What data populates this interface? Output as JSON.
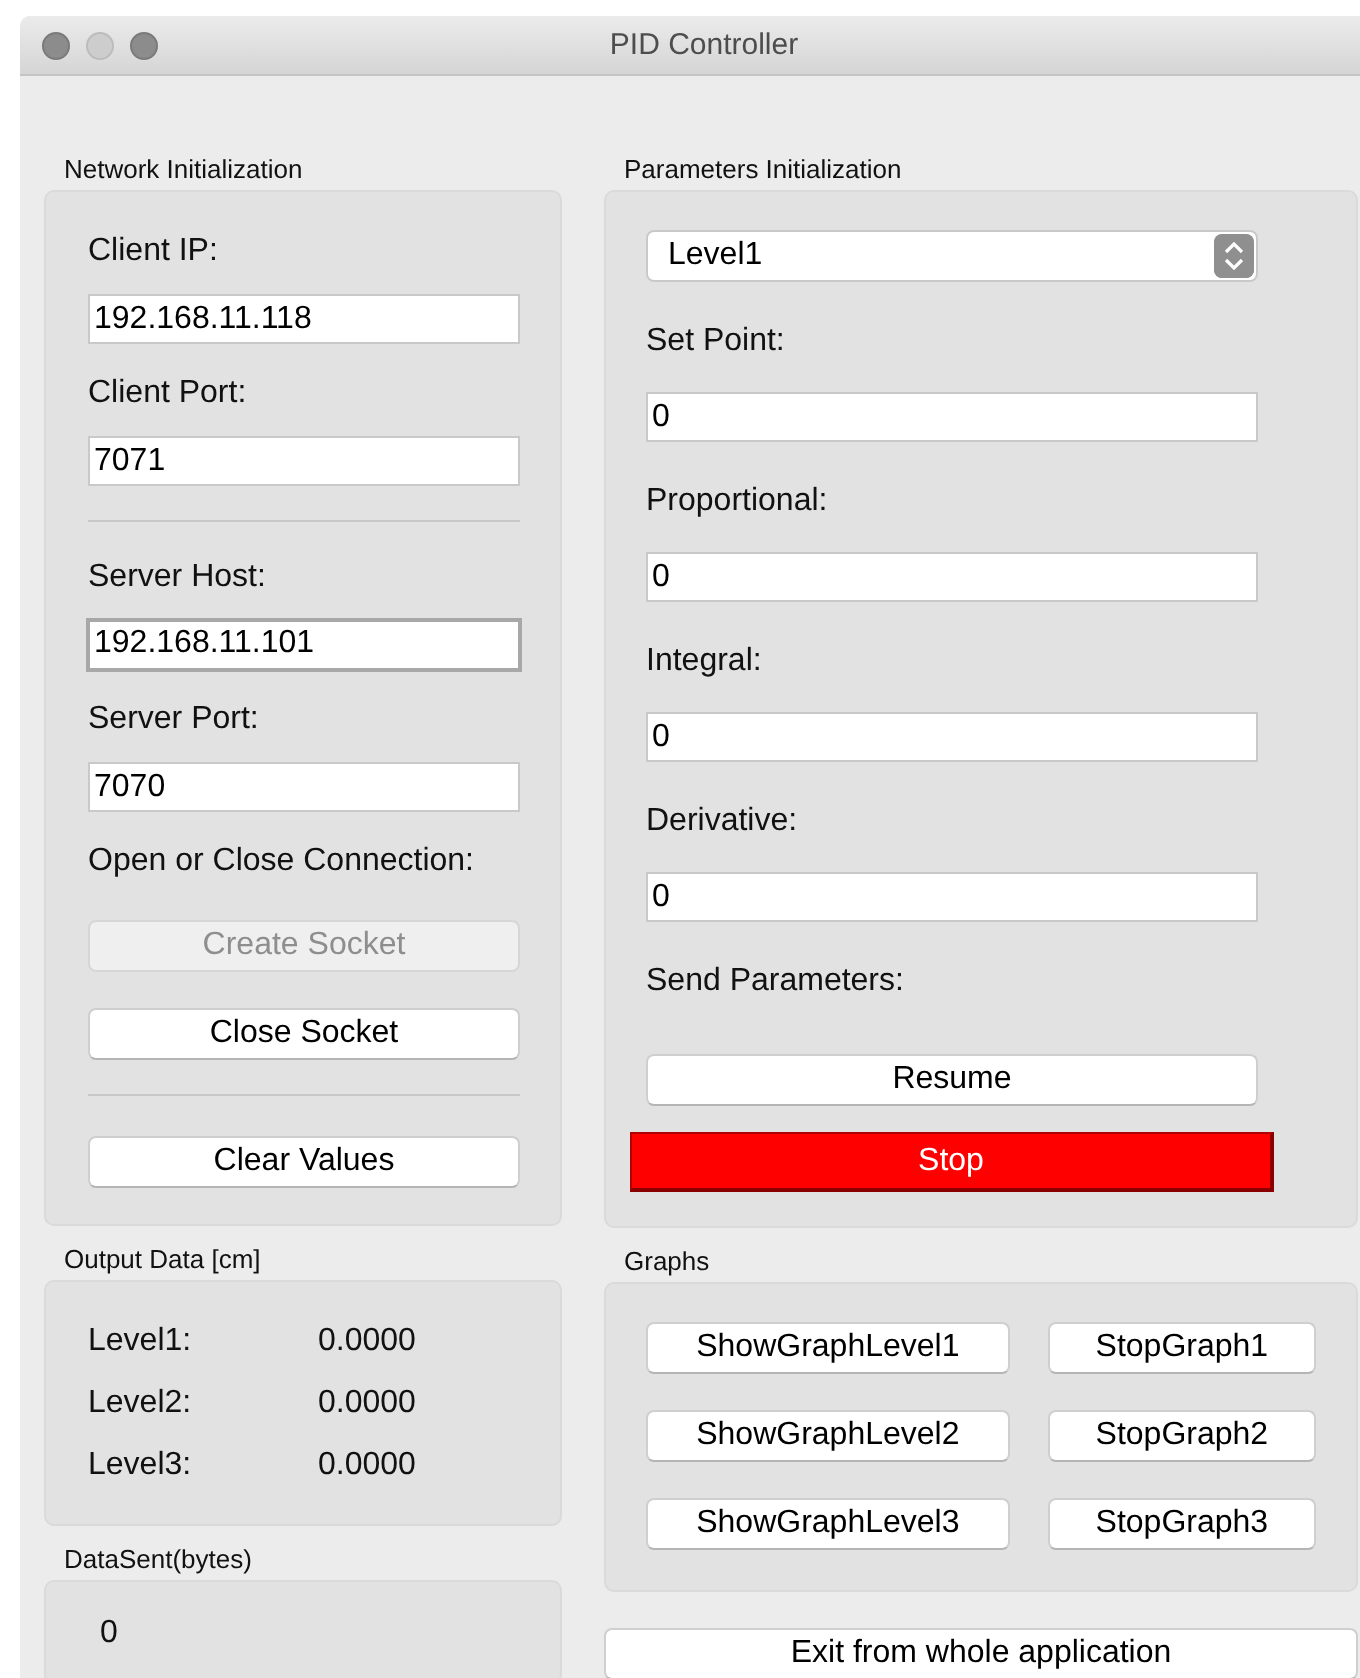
{
  "window": {
    "title": "PID Controller"
  },
  "network": {
    "title": "Network Initialization",
    "items": [
      {
        "kind": "label",
        "text": "Client IP:"
      },
      {
        "kind": "field",
        "value": "192.168.11.118",
        "focused": false
      },
      {
        "kind": "label",
        "text": "Client Port:"
      },
      {
        "kind": "field",
        "value": "7071",
        "focused": false
      },
      {
        "kind": "separator"
      },
      {
        "kind": "label",
        "text": "Server Host:"
      },
      {
        "kind": "field",
        "value": "192.168.11.101",
        "focused": true
      },
      {
        "kind": "label",
        "text": "Server Port:"
      },
      {
        "kind": "field",
        "value": "7070",
        "focused": false
      },
      {
        "kind": "label",
        "text": "Open or Close Connection:"
      },
      {
        "kind": "button",
        "label": "Create Socket",
        "disabled": true
      },
      {
        "kind": "button",
        "label": "Close Socket",
        "disabled": false
      },
      {
        "kind": "separator"
      },
      {
        "kind": "button",
        "label": "Clear Values",
        "disabled": false
      }
    ]
  },
  "parameters": {
    "title": "Parameters Initialization",
    "items": [
      {
        "kind": "select",
        "value": "Level1"
      },
      {
        "kind": "label",
        "text": "Set Point:"
      },
      {
        "kind": "field",
        "value": "0",
        "focused": false
      },
      {
        "kind": "label",
        "text": "Proportional:"
      },
      {
        "kind": "field",
        "value": "0",
        "focused": false
      },
      {
        "kind": "label",
        "text": "Integral:"
      },
      {
        "kind": "field",
        "value": "0",
        "focused": false
      },
      {
        "kind": "label",
        "text": "Derivative:"
      },
      {
        "kind": "field",
        "value": "0",
        "focused": false
      },
      {
        "kind": "label",
        "text": "Send Parameters:"
      },
      {
        "kind": "button",
        "label": "Resume",
        "disabled": false
      },
      {
        "kind": "danger",
        "label": "Stop"
      }
    ]
  },
  "output": {
    "title": "Output Data [cm]",
    "rows": [
      {
        "name": "Level1:",
        "value": "0.0000"
      },
      {
        "name": "Level2:",
        "value": "0.0000"
      },
      {
        "name": "Level3:",
        "value": "0.0000"
      }
    ]
  },
  "data_sent": {
    "title": "DataSent(bytes)",
    "value": "0"
  },
  "graphs": {
    "title": "Graphs",
    "rows": [
      {
        "show": "ShowGraphLevel1",
        "stop": "StopGraph1"
      },
      {
        "show": "ShowGraphLevel2",
        "stop": "StopGraph2"
      },
      {
        "show": "ShowGraphLevel3",
        "stop": "StopGraph3"
      }
    ]
  },
  "exit_button": "Exit from whole application"
}
